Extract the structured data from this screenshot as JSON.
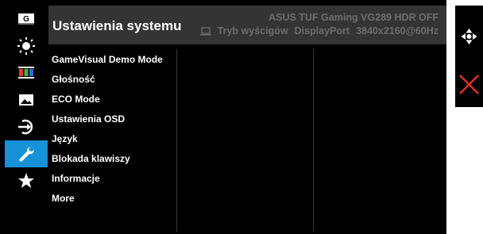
{
  "header": {
    "title": "Ustawienia systemu",
    "model": "ASUS TUF Gaming VG289 HDR OFF",
    "mode": "Tryb wyścigów",
    "input": "DisplayPort",
    "resolution": "3840x2160@60Hz"
  },
  "sidebar": {
    "items": [
      {
        "icon": "gamevisual-icon",
        "glyph": "G"
      },
      {
        "icon": "brightness-icon"
      },
      {
        "icon": "color-icon"
      },
      {
        "icon": "image-icon"
      },
      {
        "icon": "input-select-icon"
      },
      {
        "icon": "wrench-icon",
        "active": true
      },
      {
        "icon": "star-icon"
      }
    ]
  },
  "menu": {
    "items": [
      "GameVisual Demo Mode",
      "Głośność",
      "ECO Mode",
      "Ustawienia OSD",
      "Język",
      "Blokada klawiszy",
      "Informacje",
      "More"
    ]
  },
  "controls": {
    "navigate_icon": "joystick-navigate-icon",
    "close_icon": "close-icon"
  },
  "colors": {
    "active": "#1592d8",
    "header_bg": "#343434",
    "header_text": "#6d6d6d",
    "close": "#e0302a"
  }
}
